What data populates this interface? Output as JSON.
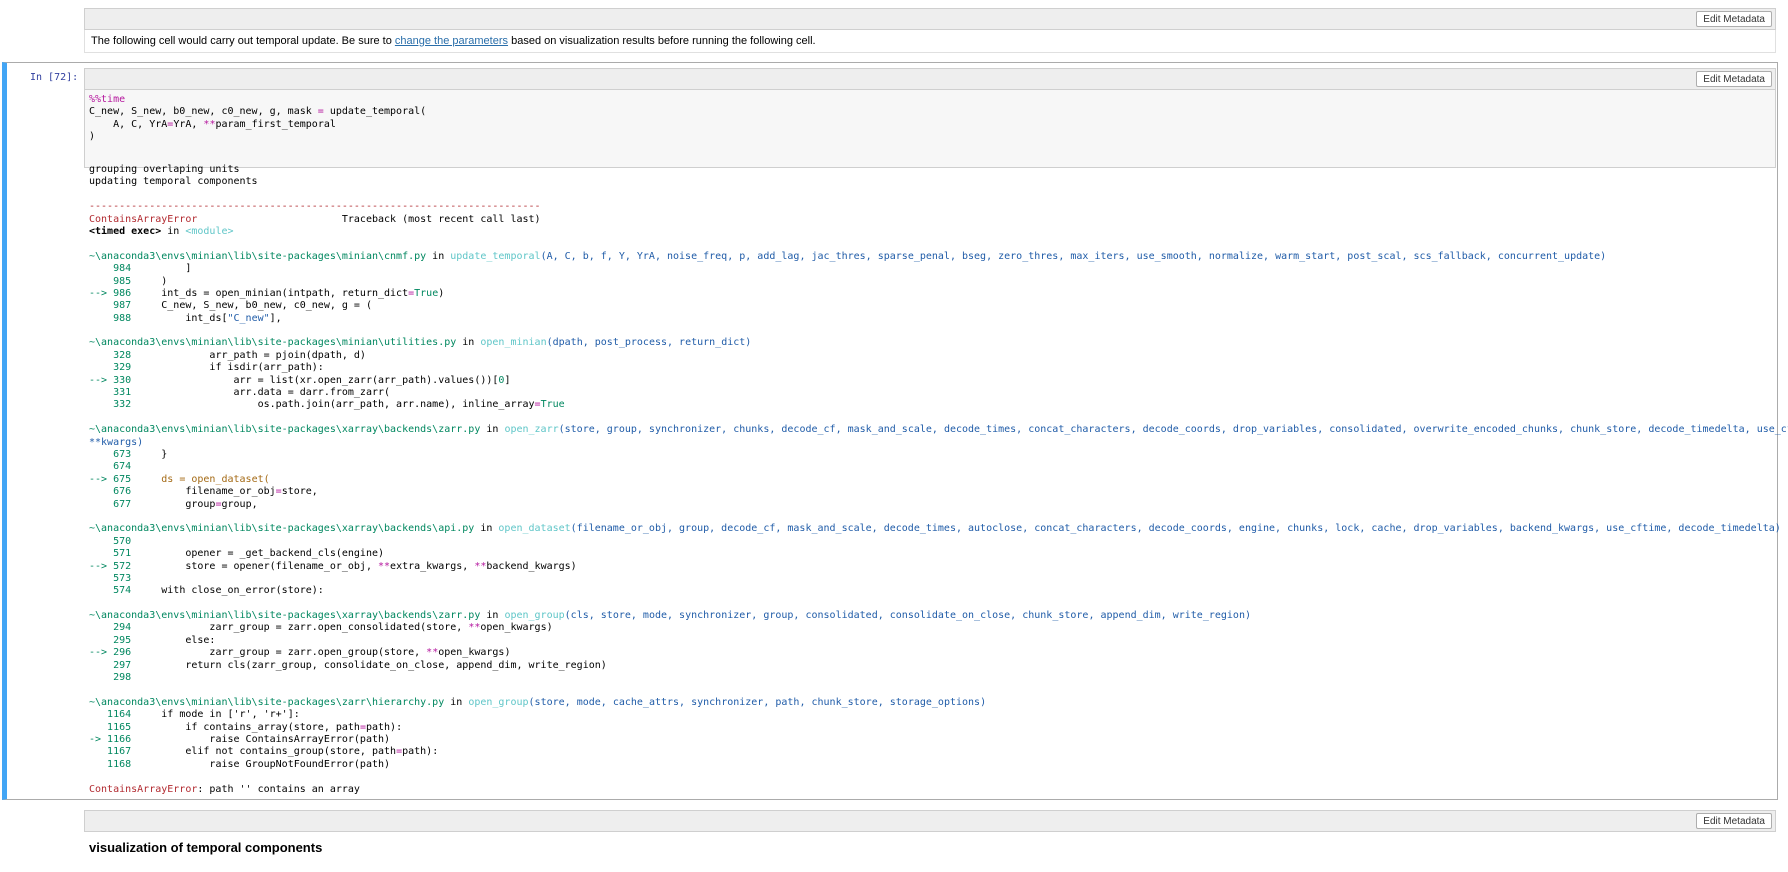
{
  "top_cell": {
    "edit_label": "Edit Metadata",
    "text_before": "The following cell would carry out temporal update. Be sure to ",
    "link_text": "change the parameters",
    "text_after": " based on visualization results before running the following cell."
  },
  "code_cell": {
    "prompt": "In [72]:",
    "edit_label": "Edit Metadata",
    "code": [
      [
        {
          "t": "%%time",
          "c": "mag"
        }
      ],
      [
        {
          "t": "C_new, S_new, b0_new, c0_new, g, mask "
        },
        {
          "t": "=",
          "c": "mag"
        },
        {
          "t": " update_temporal("
        }
      ],
      [
        {
          "t": "    A, C, YrA"
        },
        {
          "t": "=",
          "c": "mag"
        },
        {
          "t": "YrA, "
        },
        {
          "t": "**",
          "c": "mag"
        },
        {
          "t": "param_first_temporal"
        }
      ],
      [
        {
          "t": ")"
        }
      ]
    ]
  },
  "output_lines": [
    [
      {
        "t": "grouping overlaping units"
      }
    ],
    [
      {
        "t": "updating temporal components"
      }
    ],
    [
      {
        "t": ""
      }
    ],
    [
      {
        "t": "---------------------------------------------------------------------------",
        "c": "err"
      }
    ],
    [
      {
        "t": "ContainsArrayError",
        "c": "err"
      },
      {
        "t": "                        Traceback (most recent call last)"
      }
    ],
    [
      {
        "t": "<timed exec>",
        "c": "bold"
      },
      {
        "t": " in "
      },
      {
        "t": "<module>",
        "c": "cyan"
      }
    ],
    [
      {
        "t": ""
      }
    ],
    [
      {
        "t": "~\\anaconda3\\envs\\minian\\lib\\site-packages\\minian\\cnmf.py",
        "c": "grn"
      },
      {
        "t": " in "
      },
      {
        "t": "update_temporal",
        "c": "cyan"
      },
      {
        "t": "(A, C, b, f, Y, YrA, noise_freq, p, add_lag, jac_thres, sparse_penal, bseg, zero_thres, max_iters, use_smooth, normalize, warm_start, post_scal, scs_fallback, concurrent_update)",
        "c": "blue"
      }
    ],
    [
      {
        "t": "    984",
        "c": "grn"
      },
      {
        "t": "         ]"
      }
    ],
    [
      {
        "t": "    985",
        "c": "grn"
      },
      {
        "t": "     )"
      }
    ],
    [
      {
        "t": "--> 986",
        "c": "grn"
      },
      {
        "t": "     int_ds = open_minian(intpath, return_dict"
      },
      {
        "t": "=",
        "c": "mag"
      },
      {
        "t": "True",
        "c": "grn"
      },
      {
        "t": ")"
      }
    ],
    [
      {
        "t": "    987",
        "c": "grn"
      },
      {
        "t": "     C_new, S_new, b0_new, c0_new, g = ("
      }
    ],
    [
      {
        "t": "    988",
        "c": "grn"
      },
      {
        "t": "         int_ds["
      },
      {
        "t": "\"C_new\"",
        "c": "blue"
      },
      {
        "t": "],"
      }
    ],
    [
      {
        "t": ""
      }
    ],
    [
      {
        "t": "~\\anaconda3\\envs\\minian\\lib\\site-packages\\minian\\utilities.py",
        "c": "grn"
      },
      {
        "t": " in "
      },
      {
        "t": "open_minian",
        "c": "cyan"
      },
      {
        "t": "(dpath, post_process, return_dict)",
        "c": "blue"
      }
    ],
    [
      {
        "t": "    328",
        "c": "grn"
      },
      {
        "t": "             arr_path = pjoin(dpath, d)"
      }
    ],
    [
      {
        "t": "    329",
        "c": "grn"
      },
      {
        "t": "             if isdir(arr_path):"
      }
    ],
    [
      {
        "t": "--> 330",
        "c": "grn"
      },
      {
        "t": "                 arr = list(xr.open_zarr(arr_path).values())["
      },
      {
        "t": "0",
        "c": "grn"
      },
      {
        "t": "]"
      }
    ],
    [
      {
        "t": "    331",
        "c": "grn"
      },
      {
        "t": "                 arr.data = darr.from_zarr("
      }
    ],
    [
      {
        "t": "    332",
        "c": "grn"
      },
      {
        "t": "                     os.path.join(arr_path, arr.name), inline_array"
      },
      {
        "t": "=",
        "c": "mag"
      },
      {
        "t": "True",
        "c": "grn"
      }
    ],
    [
      {
        "t": ""
      }
    ],
    [
      {
        "t": "~\\anaconda3\\envs\\minian\\lib\\site-packages\\xarray\\backends\\zarr.py",
        "c": "grn"
      },
      {
        "t": " in "
      },
      {
        "t": "open_zarr",
        "c": "cyan"
      },
      {
        "t": "(store, group, synchronizer, chunks, decode_cf, mask_and_scale, decode_times, concat_characters, decode_coords, drop_variables, consolidated, overwrite_encoded_chunks, chunk_store, decode_timedelta, use_cftime,",
        "c": "blue"
      }
    ],
    [
      {
        "t": "**kwargs)",
        "c": "blue"
      }
    ],
    [
      {
        "t": "    673",
        "c": "grn"
      },
      {
        "t": "     }"
      }
    ],
    [
      {
        "t": "    674",
        "c": "grn"
      }
    ],
    [
      {
        "t": "--> 675",
        "c": "grn"
      },
      {
        "t": "     ds = open_dataset(",
        "c": "brown"
      }
    ],
    [
      {
        "t": "    676",
        "c": "grn"
      },
      {
        "t": "         filename_or_obj"
      },
      {
        "t": "=",
        "c": "mag"
      },
      {
        "t": "store,"
      }
    ],
    [
      {
        "t": "    677",
        "c": "grn"
      },
      {
        "t": "         group"
      },
      {
        "t": "=",
        "c": "mag"
      },
      {
        "t": "group,"
      }
    ],
    [
      {
        "t": ""
      }
    ],
    [
      {
        "t": "~\\anaconda3\\envs\\minian\\lib\\site-packages\\xarray\\backends\\api.py",
        "c": "grn"
      },
      {
        "t": " in "
      },
      {
        "t": "open_dataset",
        "c": "cyan"
      },
      {
        "t": "(filename_or_obj, group, decode_cf, mask_and_scale, decode_times, autoclose, concat_characters, decode_coords, engine, chunks, lock, cache, drop_variables, backend_kwargs, use_cftime, decode_timedelta)",
        "c": "blue"
      }
    ],
    [
      {
        "t": "    570",
        "c": "grn"
      }
    ],
    [
      {
        "t": "    571",
        "c": "grn"
      },
      {
        "t": "         opener = _get_backend_cls(engine)"
      }
    ],
    [
      {
        "t": "--> 572",
        "c": "grn"
      },
      {
        "t": "         store = opener(filename_or_obj, "
      },
      {
        "t": "**",
        "c": "mag"
      },
      {
        "t": "extra_kwargs, "
      },
      {
        "t": "**",
        "c": "mag"
      },
      {
        "t": "backend_kwargs)"
      }
    ],
    [
      {
        "t": "    573",
        "c": "grn"
      }
    ],
    [
      {
        "t": "    574",
        "c": "grn"
      },
      {
        "t": "     with close_on_error(store):"
      }
    ],
    [
      {
        "t": ""
      }
    ],
    [
      {
        "t": "~\\anaconda3\\envs\\minian\\lib\\site-packages\\xarray\\backends\\zarr.py",
        "c": "grn"
      },
      {
        "t": " in "
      },
      {
        "t": "open_group",
        "c": "cyan"
      },
      {
        "t": "(cls, store, mode, synchronizer, group, consolidated, consolidate_on_close, chunk_store, append_dim, write_region)",
        "c": "blue"
      }
    ],
    [
      {
        "t": "    294",
        "c": "grn"
      },
      {
        "t": "             zarr_group = zarr.open_consolidated(store, "
      },
      {
        "t": "**",
        "c": "mag"
      },
      {
        "t": "open_kwargs)"
      }
    ],
    [
      {
        "t": "    295",
        "c": "grn"
      },
      {
        "t": "         else:"
      }
    ],
    [
      {
        "t": "--> 296",
        "c": "grn"
      },
      {
        "t": "             zarr_group = zarr.open_group(store, "
      },
      {
        "t": "**",
        "c": "mag"
      },
      {
        "t": "open_kwargs)"
      }
    ],
    [
      {
        "t": "    297",
        "c": "grn"
      },
      {
        "t": "         return cls(zarr_group, consolidate_on_close, append_dim, write_region)"
      }
    ],
    [
      {
        "t": "    298",
        "c": "grn"
      }
    ],
    [
      {
        "t": ""
      }
    ],
    [
      {
        "t": "~\\anaconda3\\envs\\minian\\lib\\site-packages\\zarr\\hierarchy.py",
        "c": "grn"
      },
      {
        "t": " in "
      },
      {
        "t": "open_group",
        "c": "cyan"
      },
      {
        "t": "(store, mode, cache_attrs, synchronizer, path, chunk_store, storage_options)",
        "c": "blue"
      }
    ],
    [
      {
        "t": "   1164",
        "c": "grn"
      },
      {
        "t": "     if mode in ['r', 'r+']:"
      }
    ],
    [
      {
        "t": "   1165",
        "c": "grn"
      },
      {
        "t": "         if contains_array(store, path"
      },
      {
        "t": "=",
        "c": "mag"
      },
      {
        "t": "path):"
      }
    ],
    [
      {
        "t": "-> 1166",
        "c": "grn"
      },
      {
        "t": "             raise ContainsArrayError(path)"
      }
    ],
    [
      {
        "t": "   1167",
        "c": "grn"
      },
      {
        "t": "         elif not contains_group(store, path"
      },
      {
        "t": "=",
        "c": "mag"
      },
      {
        "t": "path):"
      }
    ],
    [
      {
        "t": "   1168",
        "c": "grn"
      },
      {
        "t": "             raise GroupNotFoundError(path)"
      }
    ],
    [
      {
        "t": ""
      }
    ],
    [
      {
        "t": "ContainsArrayError",
        "c": "err"
      },
      {
        "t": ": path '' contains an array"
      }
    ]
  ],
  "bottom_cell": {
    "edit_label": "Edit Metadata",
    "heading": "visualization of temporal components"
  }
}
